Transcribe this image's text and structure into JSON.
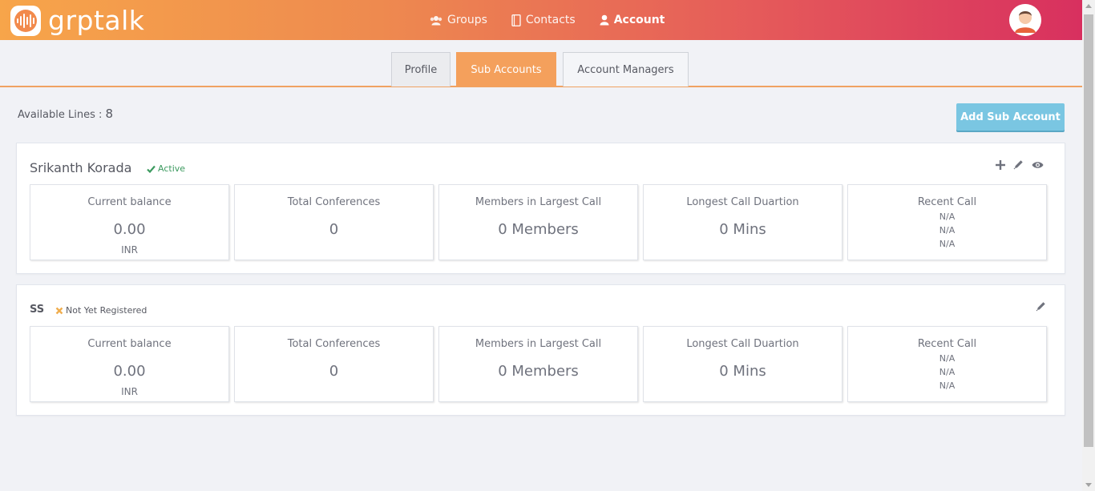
{
  "app": {
    "name": "grptalk"
  },
  "nav": {
    "items": [
      {
        "label": "Groups",
        "icon": "users-icon"
      },
      {
        "label": "Contacts",
        "icon": "address-book-icon"
      },
      {
        "label": "Account",
        "icon": "user-icon",
        "active": true
      }
    ]
  },
  "tabs": [
    {
      "label": "Profile"
    },
    {
      "label": "Sub Accounts",
      "active": true
    },
    {
      "label": "Account Managers"
    }
  ],
  "available_lines": {
    "label": "Available Lines :",
    "value": "8"
  },
  "add_button": {
    "label": "Add Sub Account"
  },
  "accounts": [
    {
      "name": "Srikanth Korada",
      "status": "Active",
      "stats": {
        "balance": {
          "label": "Current balance",
          "value": "0.00",
          "unit": "INR"
        },
        "conferences": {
          "label": "Total Conferences",
          "value": "0"
        },
        "members": {
          "label": "Members in Largest Call",
          "value": "0 Members"
        },
        "duration": {
          "label": "Longest Call Duartion",
          "value": "0 Mins"
        },
        "recent": {
          "label": "Recent Call",
          "lines": [
            "N/A",
            "N/A",
            "N/A"
          ]
        }
      }
    },
    {
      "name": "SS",
      "status": "Not Yet Registered",
      "stats": {
        "balance": {
          "label": "Current balance",
          "value": "0.00",
          "unit": "INR"
        },
        "conferences": {
          "label": "Total Conferences",
          "value": "0"
        },
        "members": {
          "label": "Members in Largest Call",
          "value": "0 Members"
        },
        "duration": {
          "label": "Longest Call Duartion",
          "value": "0 Mins"
        },
        "recent": {
          "label": "Recent Call",
          "lines": [
            "N/A",
            "N/A",
            "N/A"
          ]
        }
      }
    }
  ],
  "colors": {
    "accent": "#f4a05c",
    "button": "#7ac6e2",
    "active": "#3c9a5f",
    "warning": "#f0ad4e"
  }
}
